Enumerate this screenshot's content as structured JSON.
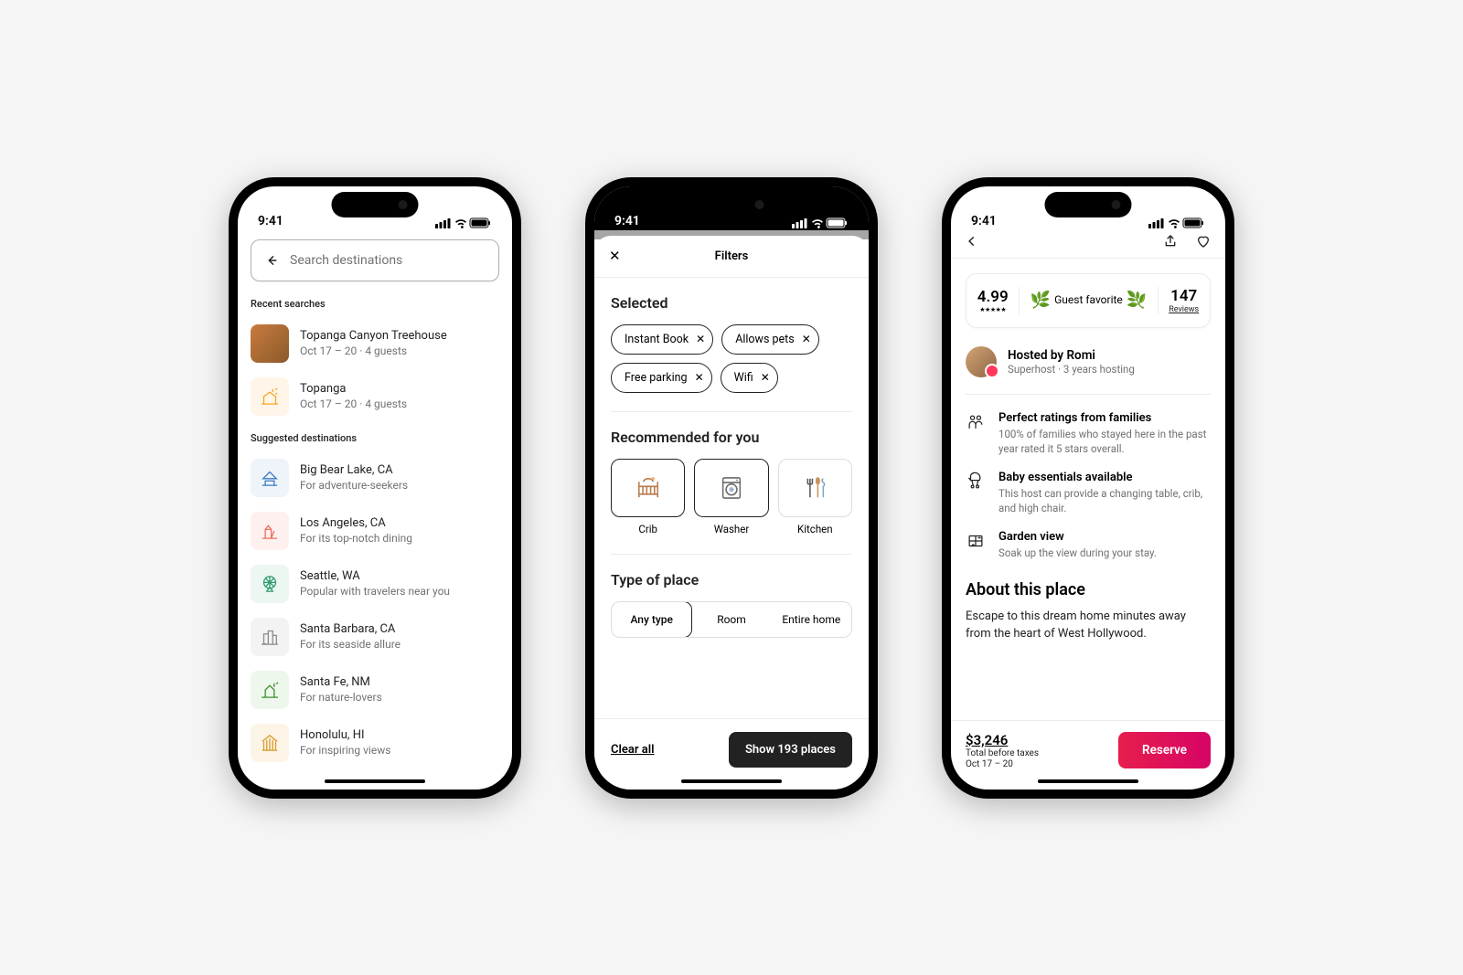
{
  "status": {
    "time": "9:41"
  },
  "colors": {
    "accent": "#ff385c",
    "gradient_start": "#e61e4d",
    "gradient_end": "#d70466"
  },
  "phone1": {
    "search_placeholder": "Search destinations",
    "recent_label": "Recent searches",
    "recent": [
      {
        "title": "Topanga Canyon Treehouse",
        "sub": "Oct 17 – 20 · 4 guests",
        "icon": "photo"
      },
      {
        "title": "Topanga",
        "sub": "Oct 17 – 20 · 4 guests",
        "icon": "cabin",
        "tint": "#f5a623"
      }
    ],
    "suggested_label": "Suggested destinations",
    "suggested": [
      {
        "title": "Big Bear Lake, CA",
        "sub": "For adventure-seekers",
        "icon": "cabin",
        "tint": "#3b7bbf"
      },
      {
        "title": "Los Angeles, CA",
        "sub": "For its top-notch dining",
        "icon": "lifeguard",
        "tint": "#e8705f"
      },
      {
        "title": "Seattle, WA",
        "sub": "Popular with travelers near you",
        "icon": "ferris",
        "tint": "#2e9b6e"
      },
      {
        "title": "Santa Barbara, CA",
        "sub": "For its seaside allure",
        "icon": "city",
        "tint": "#8a8a8a"
      },
      {
        "title": "Santa Fe, NM",
        "sub": "For nature-lovers",
        "icon": "trees",
        "tint": "#3c8d2f"
      },
      {
        "title": "Honolulu, HI",
        "sub": "For inspiring views",
        "icon": "temple",
        "tint": "#d99a2b"
      }
    ]
  },
  "phone2": {
    "title": "Filters",
    "selected_label": "Selected",
    "chips": [
      "Instant Book",
      "Allows pets",
      "Free parking",
      "Wifi"
    ],
    "recommended_label": "Recommended for you",
    "recommended": [
      {
        "label": "Crib",
        "selected": true
      },
      {
        "label": "Washer",
        "selected": true
      },
      {
        "label": "Kitchen",
        "selected": false
      }
    ],
    "type_label": "Type of place",
    "types": [
      {
        "label": "Any type",
        "selected": true
      },
      {
        "label": "Room",
        "selected": false
      },
      {
        "label": "Entire home",
        "selected": false
      }
    ],
    "clear": "Clear all",
    "show_button": "Show 193 places"
  },
  "phone3": {
    "rating": "4.99",
    "guest_favorite": "Guest favorite",
    "review_count": "147",
    "reviews_label": "Reviews",
    "host_name": "Hosted by Romi",
    "host_sub": "Superhost · 3 years hosting",
    "features": [
      {
        "title": "Perfect ratings from families",
        "sub": "100% of families who stayed here in the past year rated it 5 stars overall."
      },
      {
        "title": "Baby essentials available",
        "sub": "This host can provide a changing table, crib, and high chair."
      },
      {
        "title": "Garden view",
        "sub": "Soak up the view during your stay."
      }
    ],
    "about_heading": "About this place",
    "about_text": "Escape to this dream home minutes away from the heart of West Hollywood.",
    "price": "$3,246",
    "price_sub": "Total before taxes",
    "dates": "Oct 17 – 20",
    "reserve": "Reserve"
  }
}
